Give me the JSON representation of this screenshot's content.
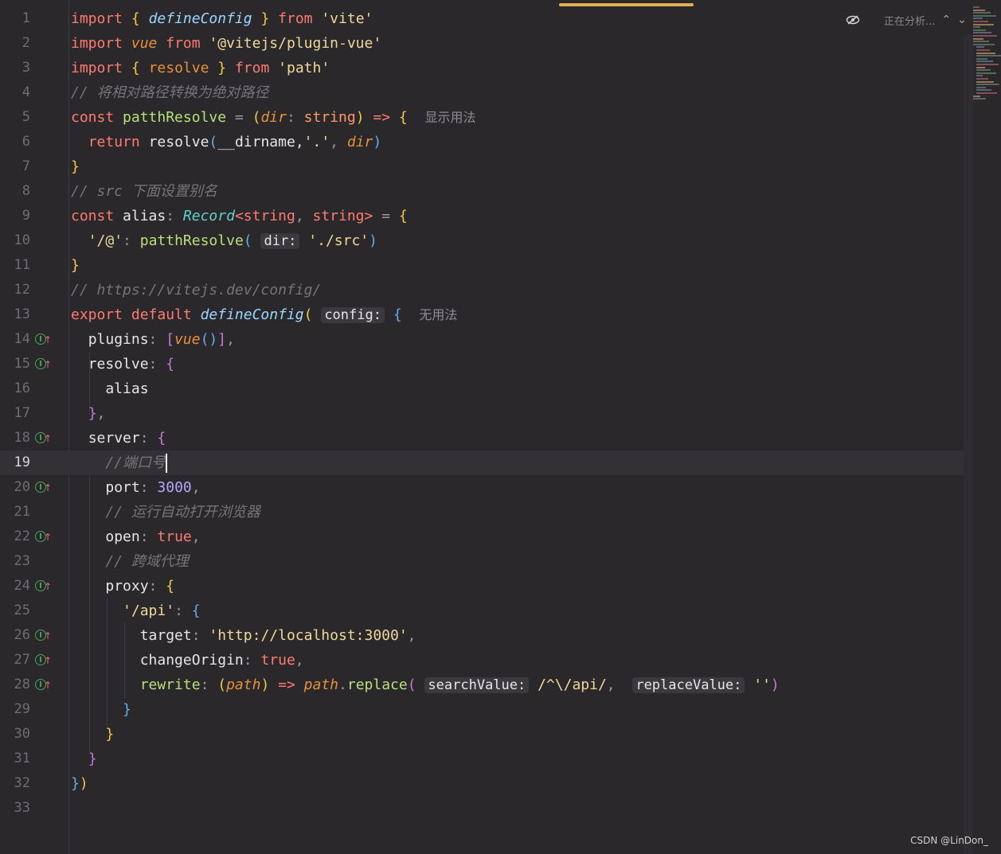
{
  "editor": {
    "status": "正在分析...",
    "watermark": "CSDN @LinDon_",
    "current_line": 19,
    "lines": [
      {
        "n": "1"
      },
      {
        "n": "2"
      },
      {
        "n": "3"
      },
      {
        "n": "4"
      },
      {
        "n": "5"
      },
      {
        "n": "6"
      },
      {
        "n": "7"
      },
      {
        "n": "8"
      },
      {
        "n": "9"
      },
      {
        "n": "10"
      },
      {
        "n": "11"
      },
      {
        "n": "12"
      },
      {
        "n": "13"
      },
      {
        "n": "14"
      },
      {
        "n": "15"
      },
      {
        "n": "16"
      },
      {
        "n": "17"
      },
      {
        "n": "18"
      },
      {
        "n": "19"
      },
      {
        "n": "20"
      },
      {
        "n": "21"
      },
      {
        "n": "22"
      },
      {
        "n": "23"
      },
      {
        "n": "24"
      },
      {
        "n": "25"
      },
      {
        "n": "26"
      },
      {
        "n": "27"
      },
      {
        "n": "28"
      },
      {
        "n": "29"
      },
      {
        "n": "30"
      },
      {
        "n": "31"
      },
      {
        "n": "32"
      },
      {
        "n": "33"
      }
    ],
    "tokens": {
      "import": "import",
      "from": "from",
      "defineConfig": "defineConfig",
      "vite": "'vite'",
      "vue": "vue",
      "plugin_vue": "'@vitejs/plugin-vue'",
      "resolve": "resolve",
      "path": "'path'",
      "comment4": "// 将相对路径转换为绝对路径",
      "const": "const",
      "patthResolve": "patthResolve",
      "dir": "dir",
      "string": "string",
      "arrow": "=>",
      "usage_hint": "显示用法",
      "return": "return",
      "dirname": "__dirname",
      "dot": "'.'",
      "comment8": "// src 下面设置别名",
      "alias": "alias",
      "Record": "Record",
      "alias_key": "'/@'",
      "dir_hint": "dir:",
      "src": "'./src'",
      "comment12": "// https://vitejs.dev/config/",
      "export": "export",
      "default": "default",
      "config_hint": "config:",
      "no_usage": "无用法",
      "plugins": "plugins",
      "resolve_key": "resolve",
      "server": "server",
      "comment19": "//端口号",
      "port": "port",
      "port_val": "3000",
      "comment21": "// 运行自动打开浏览器",
      "open": "open",
      "true": "true",
      "comment23": "// 跨域代理",
      "proxy": "proxy",
      "api_key": "'/api'",
      "target": "target",
      "target_val": "'http://localhost:3000'",
      "changeOrigin": "changeOrigin",
      "rewrite": "rewrite",
      "path_param": "path",
      "replace": "replace",
      "searchValue_hint": "searchValue:",
      "regex": "/^\\/api/",
      "replaceValue_hint": "replaceValue:",
      "empty_str": "''"
    }
  }
}
